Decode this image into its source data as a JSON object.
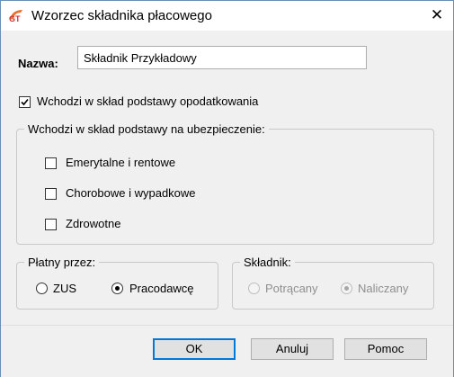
{
  "window": {
    "title": "Wzorzec składnika płacowego",
    "close_glyph": "✕",
    "icon": "gt-app-icon"
  },
  "form": {
    "name_label": "Nazwa:",
    "name_value": "Składnik Przykładowy",
    "tax_checkbox": {
      "label": "Wchodzi w skład podstawy opodatkowania",
      "checked": true
    },
    "insurance_group": {
      "legend": "Wchodzi w skład podstawy na ubezpieczenie:",
      "items": [
        {
          "label": "Emerytalne i rentowe",
          "checked": false
        },
        {
          "label": "Chorobowe i wypadkowe",
          "checked": false
        },
        {
          "label": "Zdrowotne",
          "checked": false
        }
      ]
    },
    "payer_group": {
      "legend": "Płatny przez:",
      "options": [
        {
          "label": "ZUS",
          "selected": false
        },
        {
          "label": "Pracodawcę",
          "selected": true
        }
      ]
    },
    "component_group": {
      "legend": "Składnik:",
      "options": [
        {
          "label": "Potrącany",
          "selected": false,
          "disabled": true
        },
        {
          "label": "Naliczany",
          "selected": true,
          "disabled": true
        }
      ]
    }
  },
  "buttons": {
    "ok": "OK",
    "cancel": "Anuluj",
    "help": "Pomoc"
  },
  "colors": {
    "accent": "#0078d7",
    "window_bg": "#f0f0f0",
    "icon_orange": "#e8712e",
    "icon_red": "#d0302a"
  }
}
